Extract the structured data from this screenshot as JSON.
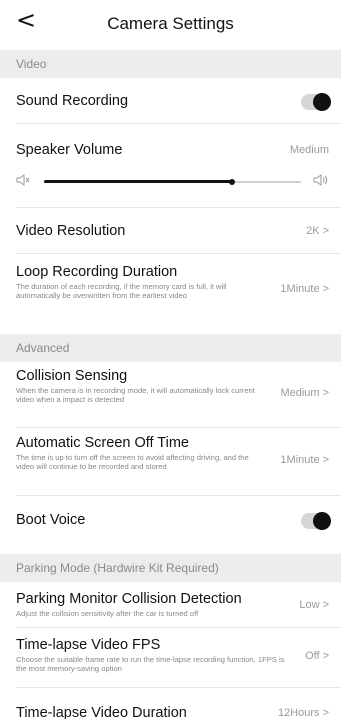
{
  "header": {
    "back_icon": "chevron-left-icon",
    "back_glyph": "<",
    "title": "Camera Settings"
  },
  "sections": {
    "video": "Video",
    "advanced": "Advanced",
    "parking": "Parking Mode (Hardwire Kit Required)"
  },
  "sound_recording": {
    "label": "Sound Recording",
    "enabled": true
  },
  "speaker_volume": {
    "label": "Speaker Volume",
    "value": "Medium",
    "level": 0.73,
    "min_icon": "volume-mute-icon",
    "max_icon": "volume-high-icon"
  },
  "video_resolution": {
    "label": "Video Resolution",
    "value": "2K"
  },
  "loop_recording": {
    "label": "Loop Recording Duration",
    "desc": "The duration of each recording, if the memory card is full, it will automatically be overwritten from the earliest video",
    "value": "1Minute"
  },
  "collision_sensing": {
    "label": "Collision Sensing",
    "desc": "When the camera is in recording mode, it will automatically lock current video when a impact is detected",
    "value": "Medium"
  },
  "screen_off": {
    "label": "Automatic Screen Off Time",
    "desc": "The time is up to turn off the screen to avoid affecting driving, and the video will continue to be recorded and stored",
    "value": "1Minute"
  },
  "boot_voice": {
    "label": "Boot Voice",
    "enabled": true
  },
  "parking_collision": {
    "label": "Parking Monitor Collision Detection",
    "desc": "Adjust the collision sensitivity after the car is turned off",
    "value": "Low"
  },
  "timelapse_fps": {
    "label": "Time-lapse Video FPS",
    "desc": "Choose the suitable frame rate to run the time-lapse recording function, 1FPS is the most memory-saving option",
    "value": "Off"
  },
  "timelapse_duration": {
    "label": "Time-lapse Video Duration",
    "value": "12Hours"
  },
  "chevron_glyph": ">",
  "colors": {
    "toggle_knob": "#111111",
    "section_bg": "#ececec",
    "muted_text": "#999999"
  }
}
